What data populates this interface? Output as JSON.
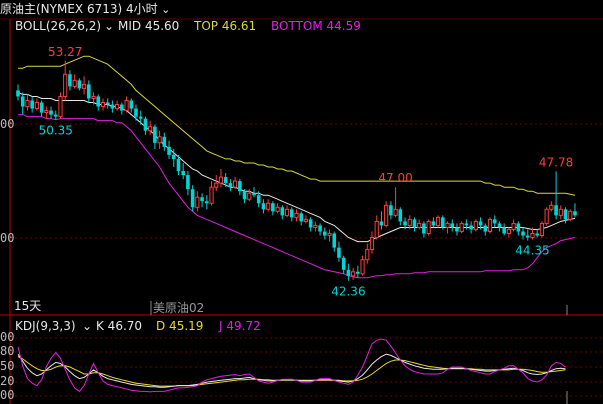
{
  "header": {
    "symbol": "原油主(NYMEX 6713)",
    "timeframe": "4小时",
    "chevron": "chevron-down-icon"
  },
  "colors": {
    "up": "#ff3b3b",
    "down": "#00d4d4",
    "mid": "#e8e8e8",
    "top": "#d8d83a",
    "bottom": "#e020e0",
    "kdj_k": "#e8e8e8",
    "kdj_d": "#e8d830",
    "kdj_j": "#e020e0",
    "grid": "#7a0000",
    "axis": "#c00000"
  },
  "boll": {
    "label": "BOLL(26,26,2)",
    "mid": "MID 45.60",
    "top": "TOP 46.61",
    "bottom": "BOTTOM 44.59"
  },
  "kdj": {
    "label": "KDJ(9,3,3)",
    "k": "K 46.70",
    "d": "D 45.19",
    "j": "J 49.72"
  },
  "period_label": "15天",
  "overlay_label": "美原油02",
  "axis_left_main": [
    "00",
    "00"
  ],
  "axis_left_kdj": [
    "00",
    "80",
    "50",
    "20",
    "00"
  ],
  "annotations": [
    {
      "text": "53.27",
      "kind": "high",
      "bar": 10
    },
    {
      "text": "50.35",
      "kind": "low",
      "bar": 8
    },
    {
      "text": "47.00",
      "kind": "high",
      "bar": 80
    },
    {
      "text": "42.36",
      "kind": "low",
      "bar": 70
    },
    {
      "text": "47.78",
      "kind": "high",
      "bar": 114
    },
    {
      "text": "44.35",
      "kind": "low",
      "bar": 109
    }
  ],
  "chart_data": {
    "type": "candlestick",
    "ylim": [
      41.5,
      54.5
    ],
    "candles": [
      [
        51.8,
        52.1,
        51.3,
        51.5
      ],
      [
        51.5,
        51.7,
        50.6,
        51.0
      ],
      [
        51.0,
        51.6,
        50.8,
        51.3
      ],
      [
        51.3,
        51.5,
        50.7,
        50.9
      ],
      [
        50.9,
        51.4,
        50.8,
        51.2
      ],
      [
        51.2,
        51.3,
        50.5,
        50.7
      ],
      [
        50.7,
        51.0,
        50.4,
        50.8
      ],
      [
        50.8,
        51.0,
        50.4,
        50.6
      ],
      [
        50.6,
        50.8,
        50.35,
        50.5
      ],
      [
        50.5,
        51.7,
        50.4,
        51.5
      ],
      [
        51.5,
        53.27,
        51.3,
        52.6
      ],
      [
        52.6,
        52.8,
        51.8,
        52.0
      ],
      [
        52.0,
        52.6,
        51.9,
        52.3
      ],
      [
        52.3,
        52.4,
        51.8,
        51.9
      ],
      [
        51.9,
        52.5,
        51.6,
        52.1
      ],
      [
        52.1,
        52.3,
        51.2,
        51.4
      ],
      [
        51.4,
        51.7,
        51.1,
        51.5
      ],
      [
        51.5,
        51.6,
        50.8,
        51.0
      ],
      [
        51.0,
        51.4,
        50.8,
        51.2
      ],
      [
        51.2,
        51.4,
        50.9,
        51.1
      ],
      [
        51.1,
        51.3,
        50.7,
        50.9
      ],
      [
        50.9,
        51.3,
        50.8,
        51.1
      ],
      [
        51.1,
        51.2,
        50.6,
        50.8
      ],
      [
        50.8,
        51.5,
        50.7,
        51.3
      ],
      [
        51.3,
        51.4,
        50.7,
        50.9
      ],
      [
        50.9,
        51.1,
        50.3,
        50.5
      ],
      [
        50.5,
        50.8,
        50.1,
        50.4
      ],
      [
        50.4,
        50.5,
        49.6,
        49.8
      ],
      [
        49.8,
        50.3,
        49.6,
        50.0
      ],
      [
        50.0,
        50.1,
        48.9,
        49.2
      ],
      [
        49.2,
        49.8,
        48.9,
        49.5
      ],
      [
        49.5,
        49.7,
        48.8,
        49.0
      ],
      [
        49.0,
        49.3,
        48.4,
        48.6
      ],
      [
        48.6,
        48.9,
        48.0,
        48.4
      ],
      [
        48.4,
        48.6,
        47.6,
        47.8
      ],
      [
        47.8,
        48.2,
        47.4,
        47.6
      ],
      [
        47.6,
        47.8,
        46.6,
        46.9
      ],
      [
        46.9,
        47.1,
        45.8,
        46.0
      ],
      [
        46.0,
        46.8,
        45.8,
        46.5
      ],
      [
        46.5,
        46.7,
        46.0,
        46.3
      ],
      [
        46.3,
        46.6,
        45.9,
        46.2
      ],
      [
        46.2,
        47.3,
        46.1,
        47.0
      ],
      [
        47.0,
        47.6,
        46.8,
        47.2
      ],
      [
        47.2,
        47.9,
        47.0,
        47.5
      ],
      [
        47.5,
        47.7,
        47.0,
        47.2
      ],
      [
        47.2,
        47.4,
        46.8,
        47.0
      ],
      [
        47.0,
        47.5,
        46.9,
        47.3
      ],
      [
        47.3,
        47.4,
        46.6,
        46.8
      ],
      [
        46.8,
        46.9,
        46.2,
        46.4
      ],
      [
        46.4,
        46.9,
        46.3,
        46.7
      ],
      [
        46.7,
        47.0,
        46.5,
        46.6
      ],
      [
        46.6,
        46.8,
        46.0,
        46.2
      ],
      [
        46.2,
        46.4,
        45.7,
        45.9
      ],
      [
        45.9,
        46.4,
        45.8,
        46.2
      ],
      [
        46.2,
        46.3,
        45.6,
        45.8
      ],
      [
        45.8,
        46.2,
        45.7,
        46.0
      ],
      [
        46.0,
        46.1,
        45.4,
        45.6
      ],
      [
        45.6,
        46.1,
        45.5,
        45.9
      ],
      [
        45.9,
        46.0,
        45.3,
        45.5
      ],
      [
        45.5,
        45.9,
        45.3,
        45.7
      ],
      [
        45.7,
        45.8,
        45.1,
        45.3
      ],
      [
        45.3,
        45.6,
        45.2,
        45.4
      ],
      [
        45.4,
        45.5,
        44.8,
        45.0
      ],
      [
        45.0,
        45.3,
        44.8,
        45.1
      ],
      [
        45.1,
        45.2,
        44.6,
        44.8
      ],
      [
        44.8,
        45.0,
        44.4,
        44.6
      ],
      [
        44.6,
        44.9,
        44.3,
        44.7
      ],
      [
        44.7,
        44.8,
        43.8,
        44.0
      ],
      [
        44.0,
        44.3,
        43.3,
        43.5
      ],
      [
        43.5,
        43.6,
        42.7,
        42.9
      ],
      [
        42.9,
        43.2,
        42.36,
        42.6
      ],
      [
        42.6,
        43.0,
        42.4,
        42.8
      ],
      [
        42.8,
        43.1,
        42.5,
        42.7
      ],
      [
        42.7,
        43.6,
        42.6,
        43.4
      ],
      [
        43.4,
        44.2,
        43.2,
        43.9
      ],
      [
        43.9,
        44.8,
        43.7,
        44.5
      ],
      [
        44.5,
        45.6,
        44.4,
        45.3
      ],
      [
        45.3,
        45.8,
        44.9,
        45.1
      ],
      [
        45.1,
        46.3,
        45.0,
        46.1
      ],
      [
        46.1,
        46.3,
        45.4,
        45.6
      ],
      [
        45.6,
        47.0,
        45.5,
        45.9
      ],
      [
        45.9,
        46.0,
        45.1,
        45.3
      ],
      [
        45.3,
        45.5,
        44.9,
        45.1
      ],
      [
        45.1,
        45.6,
        44.9,
        45.4
      ],
      [
        45.4,
        45.5,
        44.8,
        45.0
      ],
      [
        45.0,
        45.4,
        44.9,
        45.2
      ],
      [
        45.2,
        45.3,
        44.5,
        44.7
      ],
      [
        44.7,
        45.4,
        44.6,
        45.3
      ],
      [
        45.3,
        45.5,
        45.0,
        45.1
      ],
      [
        45.1,
        45.6,
        45.0,
        45.5
      ],
      [
        45.5,
        45.6,
        44.9,
        45.0
      ],
      [
        45.0,
        45.3,
        44.7,
        45.2
      ],
      [
        45.2,
        45.4,
        44.8,
        45.0
      ],
      [
        45.0,
        45.2,
        44.6,
        44.8
      ],
      [
        44.8,
        45.3,
        44.7,
        45.2
      ],
      [
        45.2,
        45.4,
        44.9,
        45.1
      ],
      [
        45.1,
        45.3,
        44.7,
        44.9
      ],
      [
        44.9,
        45.4,
        44.8,
        45.3
      ],
      [
        45.3,
        45.5,
        44.9,
        45.1
      ],
      [
        45.1,
        45.2,
        44.6,
        44.8
      ],
      [
        44.8,
        45.5,
        44.7,
        45.4
      ],
      [
        45.4,
        45.6,
        45.0,
        45.2
      ],
      [
        45.2,
        45.3,
        44.8,
        45.0
      ],
      [
        45.0,
        45.2,
        44.6,
        44.7
      ],
      [
        44.7,
        45.0,
        44.5,
        44.9
      ],
      [
        44.9,
        45.4,
        44.8,
        45.2
      ],
      [
        45.2,
        45.3,
        44.6,
        44.8
      ],
      [
        44.8,
        45.0,
        44.4,
        44.6
      ],
      [
        44.6,
        44.9,
        44.35,
        44.5
      ],
      [
        44.5,
        45.0,
        44.4,
        44.7
      ],
      [
        44.7,
        44.9,
        44.5,
        44.6
      ],
      [
        44.6,
        45.3,
        44.5,
        45.2
      ],
      [
        45.2,
        46.0,
        45.1,
        45.9
      ],
      [
        45.9,
        46.3,
        45.8,
        46.1
      ],
      [
        46.1,
        47.78,
        45.4,
        45.6
      ],
      [
        45.6,
        46.1,
        45.4,
        45.9
      ],
      [
        45.9,
        46.0,
        45.2,
        45.4
      ],
      [
        45.4,
        45.9,
        45.3,
        45.8
      ],
      [
        45.8,
        46.2,
        45.5,
        45.6
      ]
    ],
    "mid": [
      51.7,
      51.6,
      51.6,
      51.5,
      51.5,
      51.4,
      51.4,
      51.4,
      51.3,
      51.3,
      51.3,
      51.3,
      51.3,
      51.3,
      51.3,
      51.2,
      51.2,
      51.1,
      51.1,
      51.1,
      51.0,
      51.0,
      50.9,
      50.8,
      50.6,
      50.4,
      50.2,
      50.0,
      49.8,
      49.6,
      49.3,
      49.1,
      48.9,
      48.7,
      48.5,
      48.3,
      48.1,
      47.9,
      47.8,
      47.6,
      47.5,
      47.4,
      47.3,
      47.2,
      47.1,
      47.0,
      47.0,
      46.9,
      46.8,
      46.8,
      46.7,
      46.7,
      46.6,
      46.6,
      46.5,
      46.4,
      46.3,
      46.2,
      46.1,
      46.0,
      45.9,
      45.8,
      45.7,
      45.6,
      45.5,
      45.3,
      45.2,
      45.1,
      44.9,
      44.7,
      44.5,
      44.4,
      44.3,
      44.3,
      44.3,
      44.4,
      44.5,
      44.6,
      44.7,
      44.8,
      44.9,
      45.0,
      45.0,
      45.0,
      45.0,
      45.0,
      45.0,
      45.0,
      45.0,
      45.0,
      45.0,
      45.0,
      45.0,
      45.0,
      45.0,
      45.0,
      45.0,
      45.0,
      45.0,
      45.0,
      45.0,
      45.0,
      45.0,
      45.0,
      45.0,
      45.0,
      45.0,
      45.0,
      44.95,
      44.9,
      44.9,
      44.95,
      45.0,
      45.1,
      45.2,
      45.3,
      45.35,
      45.4,
      45.45
    ],
    "top": [
      52.9,
      52.9,
      53.0,
      53.0,
      53.0,
      53.0,
      53.0,
      53.0,
      53.0,
      53.0,
      53.1,
      53.2,
      53.3,
      53.4,
      53.5,
      53.5,
      53.4,
      53.3,
      53.2,
      53.1,
      52.9,
      52.7,
      52.5,
      52.3,
      52.1,
      51.8,
      51.6,
      51.4,
      51.2,
      51.0,
      50.8,
      50.6,
      50.4,
      50.2,
      50.0,
      49.8,
      49.6,
      49.4,
      49.2,
      49.0,
      48.8,
      48.7,
      48.6,
      48.5,
      48.4,
      48.4,
      48.3,
      48.3,
      48.2,
      48.2,
      48.2,
      48.1,
      48.1,
      48.0,
      48.0,
      47.9,
      47.9,
      47.8,
      47.8,
      47.7,
      47.6,
      47.5,
      47.4,
      47.4,
      47.3,
      47.3,
      47.3,
      47.3,
      47.3,
      47.3,
      47.3,
      47.3,
      47.3,
      47.3,
      47.3,
      47.3,
      47.3,
      47.3,
      47.3,
      47.3,
      47.3,
      47.3,
      47.3,
      47.3,
      47.3,
      47.3,
      47.3,
      47.3,
      47.3,
      47.3,
      47.3,
      47.3,
      47.3,
      47.3,
      47.3,
      47.3,
      47.3,
      47.3,
      47.3,
      47.2,
      47.2,
      47.1,
      47.1,
      47.0,
      47.0,
      47.0,
      46.9,
      46.9,
      46.8,
      46.8,
      46.7,
      46.7,
      46.7,
      46.7,
      46.7,
      46.7,
      46.7,
      46.65,
      46.6
    ],
    "bottom": [
      50.6,
      50.6,
      50.5,
      50.5,
      50.5,
      50.5,
      50.4,
      50.4,
      50.35,
      50.4,
      50.4,
      50.4,
      50.4,
      50.4,
      50.4,
      50.4,
      50.4,
      50.3,
      50.3,
      50.3,
      50.3,
      50.2,
      50.2,
      50.0,
      49.8,
      49.5,
      49.2,
      48.9,
      48.6,
      48.3,
      48.0,
      47.6,
      47.2,
      46.9,
      46.6,
      46.3,
      46.0,
      45.8,
      45.6,
      45.5,
      45.4,
      45.3,
      45.2,
      45.1,
      45.0,
      44.9,
      44.8,
      44.7,
      44.6,
      44.5,
      44.4,
      44.3,
      44.2,
      44.1,
      44.0,
      43.9,
      43.8,
      43.7,
      43.6,
      43.5,
      43.4,
      43.3,
      43.2,
      43.1,
      43.0,
      42.9,
      42.85,
      42.8,
      42.75,
      42.7,
      42.6,
      42.55,
      42.5,
      42.5,
      42.5,
      42.55,
      42.6,
      42.6,
      42.65,
      42.65,
      42.7,
      42.7,
      42.7,
      42.7,
      42.75,
      42.75,
      42.75,
      42.8,
      42.8,
      42.8,
      42.8,
      42.8,
      42.8,
      42.8,
      42.8,
      42.8,
      42.8,
      42.8,
      42.8,
      42.85,
      42.85,
      42.85,
      42.85,
      42.85,
      42.85,
      42.9,
      42.9,
      42.9,
      43.0,
      43.2,
      43.5,
      43.8,
      44.0,
      44.1,
      44.2,
      44.35,
      44.4,
      44.45,
      44.5
    ],
    "kdj": {
      "ylim": [
        0,
        100
      ],
      "k": [
        72,
        60,
        48,
        40,
        35,
        38,
        45,
        52,
        58,
        56,
        50,
        42,
        35,
        30,
        32,
        38,
        45,
        40,
        34,
        30,
        28,
        26,
        24,
        22,
        20,
        19,
        18,
        17,
        16,
        16,
        15,
        15,
        16,
        17,
        18,
        18,
        18,
        19,
        20,
        22,
        24,
        25,
        26,
        27,
        28,
        29,
        30,
        30,
        31,
        32,
        30,
        28,
        27,
        26,
        26,
        27,
        28,
        28,
        28,
        27,
        26,
        26,
        26,
        27,
        28,
        28,
        28,
        27,
        26,
        25,
        24,
        26,
        30,
        36,
        45,
        55,
        62,
        68,
        72,
        70,
        66,
        62,
        58,
        55,
        52,
        50,
        48,
        47,
        46,
        46,
        46,
        47,
        48,
        48,
        48,
        47,
        46,
        45,
        44,
        43,
        43,
        44,
        45,
        46,
        47,
        48,
        46,
        44,
        40,
        38,
        37,
        38,
        40,
        44,
        47,
        48,
        46.7
      ],
      "d": [
        68,
        64,
        58,
        52,
        47,
        44,
        44,
        46,
        50,
        52,
        52,
        50,
        46,
        42,
        38,
        38,
        40,
        40,
        38,
        35,
        32,
        30,
        28,
        26,
        24,
        22,
        21,
        20,
        19,
        18,
        17,
        17,
        17,
        17,
        18,
        18,
        18,
        18,
        19,
        20,
        21,
        22,
        23,
        24,
        25,
        26,
        27,
        28,
        28,
        29,
        29,
        29,
        28,
        28,
        27,
        27,
        27,
        27,
        27,
        27,
        27,
        27,
        27,
        27,
        27,
        27,
        27,
        27,
        27,
        26,
        26,
        26,
        27,
        29,
        33,
        38,
        44,
        50,
        56,
        60,
        62,
        62,
        61,
        59,
        57,
        55,
        53,
        51,
        50,
        49,
        48,
        47,
        47,
        47,
        47,
        47,
        47,
        46,
        46,
        45,
        45,
        45,
        45,
        45,
        45,
        46,
        46,
        46,
        45,
        44,
        42,
        41,
        41,
        42,
        43,
        44,
        45.19
      ],
      "j": [
        85,
        52,
        30,
        22,
        18,
        28,
        50,
        65,
        75,
        65,
        46,
        28,
        14,
        8,
        18,
        38,
        56,
        40,
        26,
        20,
        18,
        16,
        14,
        12,
        10,
        9,
        8,
        8,
        7,
        8,
        8,
        8,
        10,
        12,
        14,
        14,
        15,
        16,
        18,
        24,
        28,
        30,
        32,
        34,
        35,
        36,
        37,
        35,
        37,
        38,
        32,
        26,
        24,
        22,
        24,
        27,
        29,
        29,
        29,
        27,
        24,
        24,
        24,
        27,
        30,
        30,
        30,
        27,
        24,
        22,
        20,
        24,
        36,
        50,
        70,
        90,
        96,
        98,
        96,
        86,
        74,
        62,
        52,
        46,
        42,
        40,
        38,
        38,
        38,
        38,
        40,
        46,
        50,
        50,
        50,
        47,
        44,
        42,
        40,
        38,
        38,
        42,
        45,
        48,
        52,
        52,
        46,
        40,
        30,
        26,
        24,
        28,
        36,
        52,
        58,
        56,
        49.72
      ]
    }
  }
}
